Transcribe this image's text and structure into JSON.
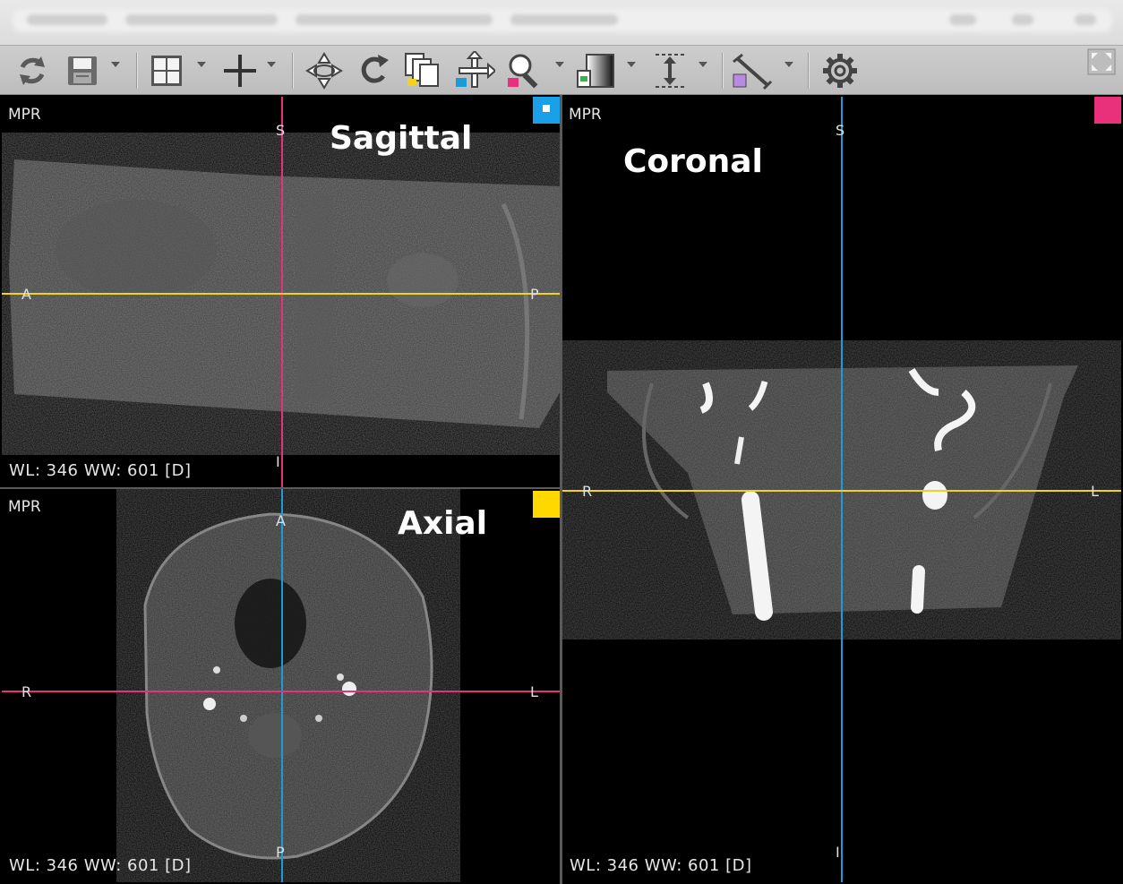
{
  "toolbar": {
    "icons": [
      "refresh-icon",
      "save-icon",
      "layout-icon",
      "crosshair-icon",
      "rotate3d-icon",
      "rotate-icon",
      "stack-icon",
      "pan-icon",
      "zoom-icon",
      "window-level-icon",
      "thickness-icon",
      "measure-icon",
      "settings-icon",
      "fullscreen-icon"
    ]
  },
  "viewports": {
    "sagittal": {
      "mode": "MPR",
      "title": "Sagittal",
      "window_info": "WL: 346 WW: 601 [D]",
      "orient": {
        "top": "S",
        "bottom": "I",
        "left": "A",
        "right": "P"
      },
      "marker_color": "#1aa0e8"
    },
    "axial": {
      "mode": "MPR",
      "title": "Axial",
      "window_info": "WL: 346 WW: 601 [D]",
      "orient": {
        "top": "A",
        "bottom": "P",
        "left": "R",
        "right": "L"
      },
      "marker_color": "#ffd800"
    },
    "coronal": {
      "mode": "MPR",
      "title": "Coronal",
      "window_info": "WL: 346 WW: 601 [D]",
      "orient": {
        "top": "S",
        "bottom": "I",
        "left": "R",
        "right": "L"
      },
      "marker_color": "#e8317a"
    }
  },
  "colors": {
    "crosshair_pink": "#e8317a",
    "crosshair_yellow": "#f2d21a",
    "crosshair_blue": "#1e9ad6"
  }
}
